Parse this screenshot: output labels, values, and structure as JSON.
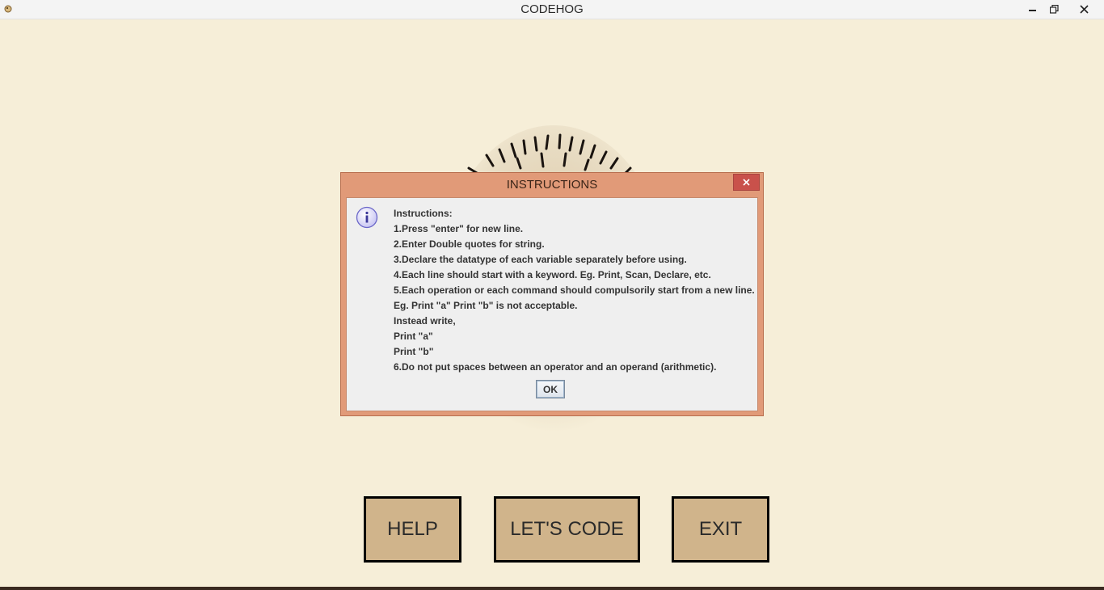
{
  "window": {
    "title": "CODEHOG",
    "icon": "hedgehog-app-icon"
  },
  "window_controls": {
    "minimize_icon": "minimize-icon",
    "maximize_icon": "restore-icon",
    "close_icon": "close-icon"
  },
  "dialog": {
    "title": "INSTRUCTIONS",
    "icon": "info-icon",
    "lines": [
      "Instructions:",
      "1.Press \"enter\" for new line.",
      "2.Enter Double quotes for string.",
      "3.Declare the datatype of each variable separately before using.",
      "4.Each line should start with a keyword. Eg. Print, Scan, Declare, etc.",
      "5.Each operation or each command should compulsorily start from a new line.",
      "Eg. Print \"a\" Print \"b\" is not acceptable.",
      "Instead write,",
      "Print \"a\"",
      "Print \"b\"",
      "6.Do not put spaces between an operator and an operand (arithmetic)."
    ],
    "ok_label": "OK"
  },
  "main": {
    "help_label": "HELP",
    "code_label": "LET'S CODE",
    "exit_label": "EXIT"
  },
  "colors": {
    "background": "#f6eed8",
    "dialog_frame": "#e19a78",
    "dialog_close": "#c9514b",
    "button_fill": "#d0b48b"
  }
}
